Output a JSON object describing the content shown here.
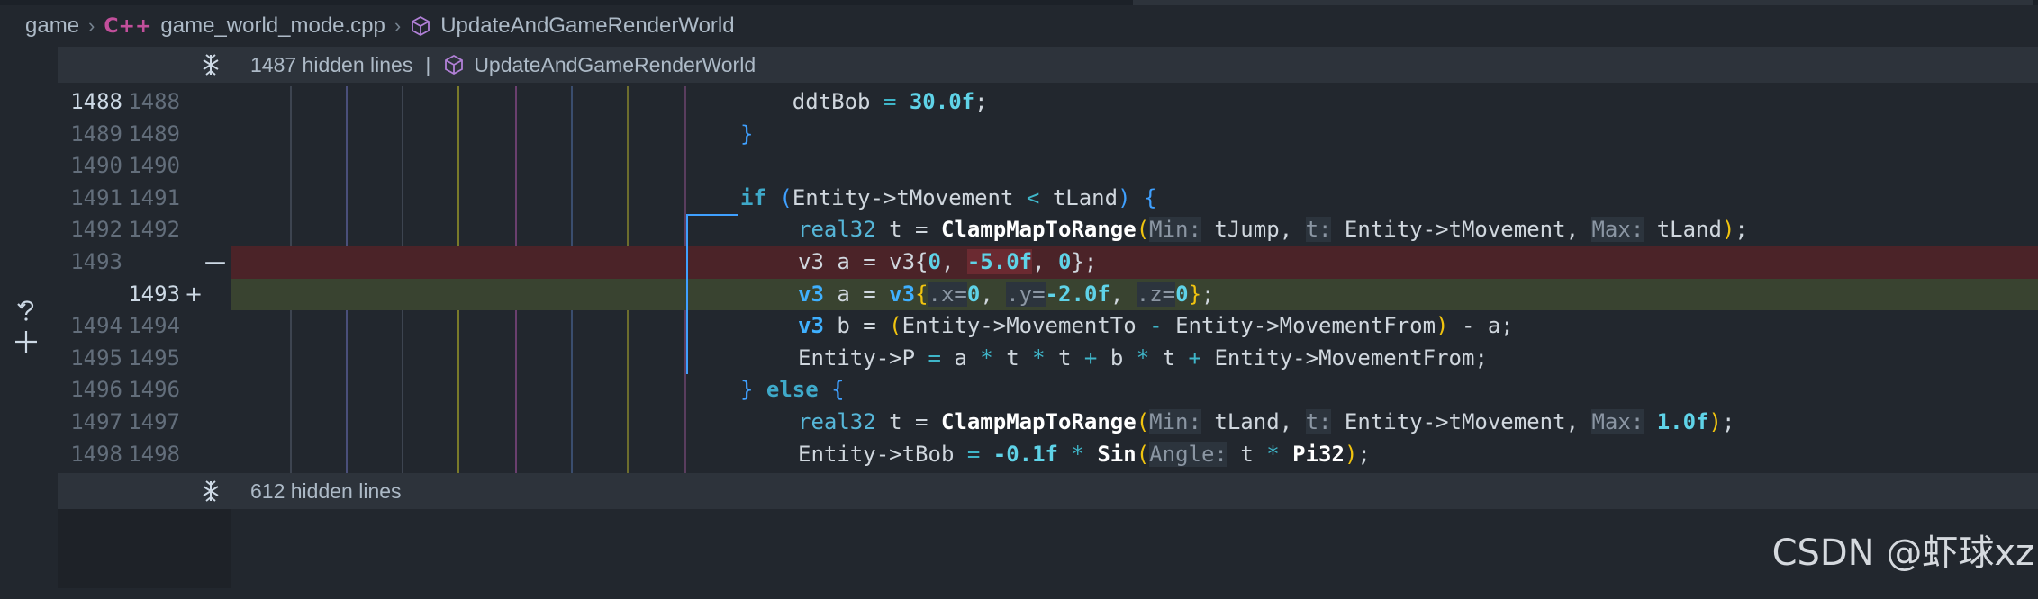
{
  "breadcrumb": {
    "root": "game",
    "file": "game_world_mode.cpp",
    "file_icon": "C++",
    "symbol": "UpdateAndGameRenderWorld"
  },
  "fold_top": {
    "text": "1487 hidden lines",
    "separator": "|",
    "symbol": "UpdateAndGameRenderWorld"
  },
  "fold_bottom": {
    "text": "612 hidden lines"
  },
  "lines": [
    {
      "old": "1488",
      "new": "1488",
      "kind": "context",
      "active": true
    },
    {
      "old": "1489",
      "new": "1489",
      "kind": "context"
    },
    {
      "old": "1490",
      "new": "1490",
      "kind": "context"
    },
    {
      "old": "1491",
      "new": "1491",
      "kind": "context"
    },
    {
      "old": "1492",
      "new": "1492",
      "kind": "context"
    },
    {
      "old": "1493",
      "new": "",
      "kind": "removed",
      "marker": "—"
    },
    {
      "old": "",
      "new": "1493",
      "kind": "added",
      "marker": "+"
    },
    {
      "old": "1494",
      "new": "1494",
      "kind": "context"
    },
    {
      "old": "1495",
      "new": "1495",
      "kind": "context"
    },
    {
      "old": "1496",
      "new": "1496",
      "kind": "context"
    },
    {
      "old": "1497",
      "new": "1497",
      "kind": "context"
    },
    {
      "old": "1498",
      "new": "1498",
      "kind": "context"
    }
  ],
  "code": {
    "l1": {
      "indent": "    ",
      "a": "ddtBob",
      "b": " = ",
      "c": "30.0f",
      "d": ";"
    },
    "l2": {
      "brace": "}"
    },
    "l4": {
      "if": "if",
      "p1": " (",
      "a": "Entity->tMovement",
      "lt": " < ",
      "b": "tLand",
      "p2": ") ",
      "brace": "{"
    },
    "l5": {
      "type": "real32",
      "t": " t = ",
      "fn": "ClampMapToRange",
      "open": "(",
      "h1": "Min:",
      "a1": " tJump",
      "c1": ", ",
      "h2": "t:",
      "a2": " Entity->tMovement",
      "c2": ", ",
      "h3": "Max:",
      "a3": " tLand",
      "close": ")",
      "semi": ";"
    },
    "l6": {
      "text": "v3 a = v3{",
      "n1": "0",
      "c1": ", ",
      "n2": "-5.0f",
      "c2": ", ",
      "n3": "0",
      "end": "};"
    },
    "l7": {
      "type": "v3",
      "mid": " a = ",
      "ctor": "v3",
      "open": "{",
      "h1": ".x=",
      "n1": "0",
      "c1": ", ",
      "h2": ".y=",
      "n2": "-2.0",
      "f": "f",
      "c2": ", ",
      "h3": ".z=",
      "n3": "0",
      "close": "}",
      "semi": ";"
    },
    "l8": {
      "type": "v3",
      "mid": " b = ",
      "open": "(",
      "a": "Entity->MovementTo",
      "minus": " - ",
      "b": "Entity->MovementFrom",
      "close": ")",
      "rest": " - a;"
    },
    "l9": {
      "a": "Entity->P",
      "eq": " = ",
      "b": "a",
      "s1": " * ",
      "c": "t",
      "s2": " * ",
      "d": "t",
      "p": " + ",
      "e": "b",
      "s3": " * ",
      "f": "t",
      "p2": " + ",
      "g": "Entity->MovementFrom",
      "semi": ";"
    },
    "l10": {
      "brace": "}",
      "else": " else",
      "open": " {"
    },
    "l11": {
      "type": "real32",
      "t": " t = ",
      "fn": "ClampMapToRange",
      "open": "(",
      "h1": "Min:",
      "a1": " tLand",
      "c1": ", ",
      "h2": "t:",
      "a2": " Entity->tMovement",
      "c2": ", ",
      "h3": "Max:",
      "n": " 1.0f",
      "close": ")",
      "semi": ";"
    },
    "l12": {
      "a": "Entity->tBob",
      "eq": " = ",
      "n": "-0.1f",
      "s": " * ",
      "fn": "Sin",
      "open": "(",
      "h": "Angle:",
      "b": " t",
      "s2": " * ",
      "pi": "Pi32",
      "close": ")",
      "semi": ";"
    }
  },
  "watermark": "CSDN @虾球xz",
  "colors": {
    "background": "#22272e",
    "removed": "#4b2328",
    "added": "#394330",
    "fold_bar": "#2d333b"
  }
}
